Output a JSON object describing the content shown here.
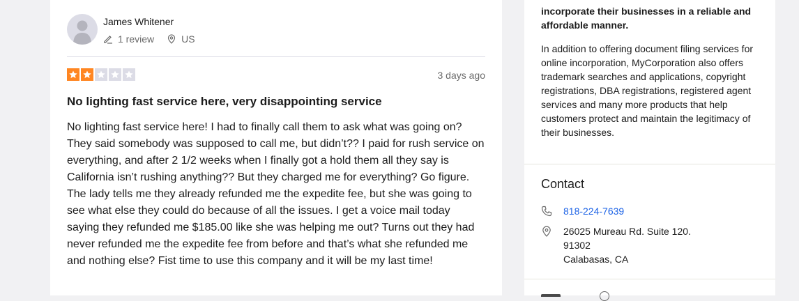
{
  "review": {
    "reviewer": {
      "name": "James Whitener",
      "review_count": "1 review",
      "country": "US"
    },
    "rating": 2,
    "rating_max": 5,
    "star_color_filled": "#ff8622",
    "star_color_empty": "#dcdce6",
    "date": "3 days ago",
    "title": "No lighting fast service here, very disappointing service",
    "body": "No lighting fast service here! I had to finally call them to ask what was going on? They said somebody was supposed to call me, but didn’t?? I paid for rush service on everything, and after 2 1/2 weeks when I finally got a hold them all they say is California isn’t rushing anything?? But they charged me for everything? Go figure. The lady tells me they already refunded me the expedite fee, but she was going to see what else they could do because of all the issues. I get a voice mail today saying they refunded me $185.00 like she was helping me out? Turns out they had never refunded me the expedite fee from before and that’s what she refunded me and nothing else? Fist time to use this company and it will be my last time!"
  },
  "sidebar": {
    "about_bold": "incorporate their businesses in a reliable and affordable manner.",
    "about_text": "In addition to offering document filing services for online incorporation, MyCorporation also offers trademark searches and applications, copyright registrations, DBA registrations, registered agent services and many more products that help customers protect and maintain the legitimacy of their businesses.",
    "contact": {
      "heading": "Contact",
      "phone": "818-224-7639",
      "address_line1": "26025 Mureau Rd. Suite 120.",
      "address_line2": "91302",
      "address_line3": "Calabasas, CA"
    }
  },
  "colors": {
    "link": "#1e64e6",
    "star_filled": "#ff8622",
    "page_bg": "#f1f1f3"
  }
}
